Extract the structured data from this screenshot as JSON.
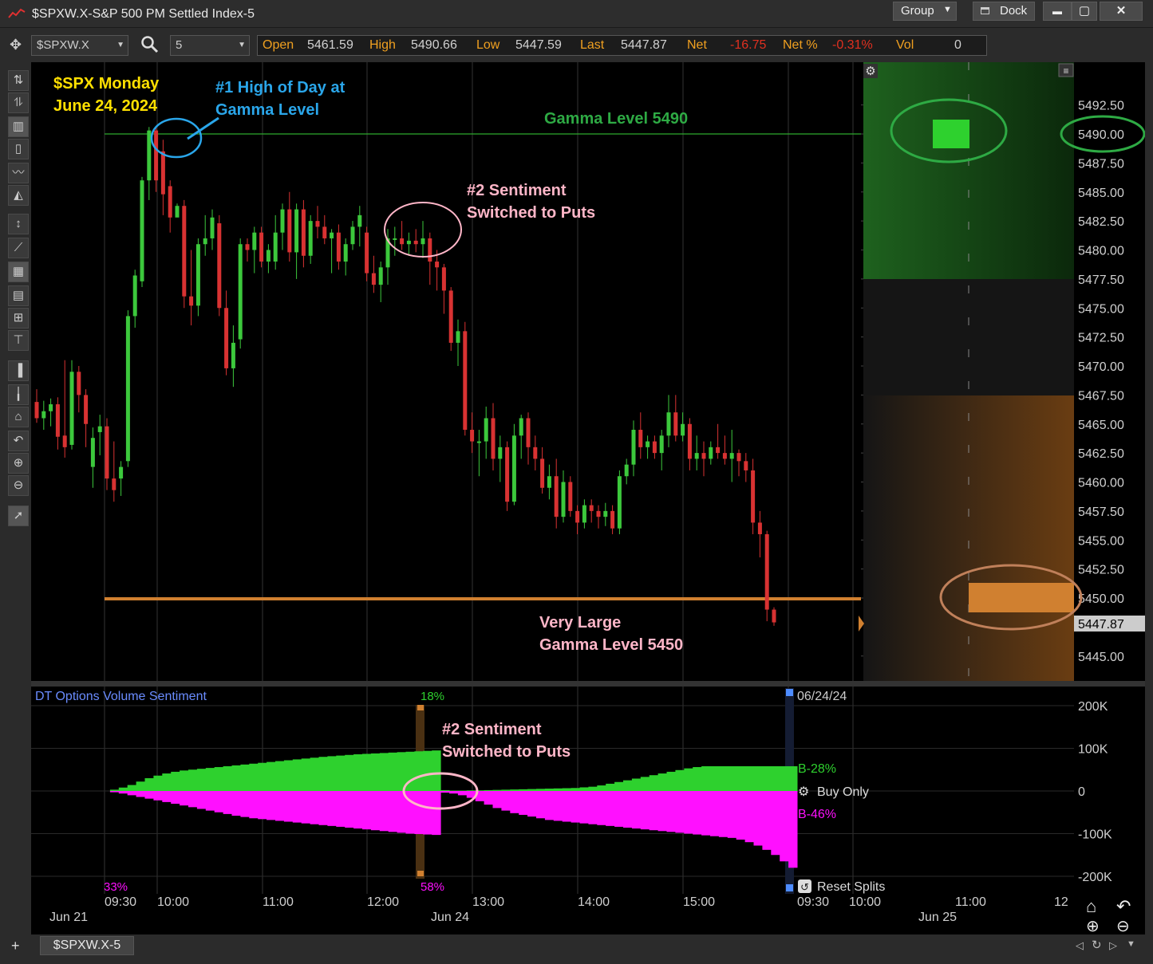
{
  "window": {
    "title": "$SPXW.X-S&P 500 PM Settled Index-5",
    "group_label": "Group",
    "dock_label": "Dock",
    "minimize_label": "▬",
    "maximize_label": "▢",
    "close_label": "✕"
  },
  "toolbar": {
    "symbol": "$SPXW.X",
    "interval": "5"
  },
  "quote": {
    "open_label": "Open",
    "open_value": "5461.59",
    "high_label": "High",
    "high_value": "5490.66",
    "low_label": "Low",
    "low_value": "5447.59",
    "last_label": "Last",
    "last_value": "5447.87",
    "net_label": "Net",
    "net_value": "-16.75",
    "netpct_label": "Net %",
    "netpct_value": "-0.31%",
    "vol_label": "Vol",
    "vol_value": "0"
  },
  "annotations": {
    "title_line1": "$SPX Monday",
    "title_line2": "June 24, 2024",
    "high_line1": "#1 High of Day at",
    "high_line2": "Gamma Level",
    "gamma_top": "Gamma Level 5490",
    "sentiment_line1": "#2 Sentiment",
    "sentiment_line2": "Switched to Puts",
    "gamma_bottom_line1": "Very Large",
    "gamma_bottom_line2": "Gamma Level 5450",
    "lower_sentiment_line1": "#2 Sentiment",
    "lower_sentiment_line2": "Switched to Puts"
  },
  "colors": {
    "bull": "#3cc83c",
    "bear": "#d83232",
    "gamma_top_line": "#2eaa2e",
    "gamma_bottom_line": "#d08030",
    "sentiment_calls": "#2ed12e",
    "sentiment_puts": "#ff10ff",
    "title_text": "#ffe000",
    "annotation_blue": "#2aa6ea",
    "annotation_green": "#2eaa44",
    "annotation_pink": "#ffb6c8"
  },
  "chart_data": [
    {
      "type": "candlestick",
      "title": "$SPXW.X-S&P 500 PM Settled Index-5",
      "interval_minutes": 5,
      "price_ticks": [
        "5492.50",
        "5490.00",
        "5487.50",
        "5485.00",
        "5482.50",
        "5480.00",
        "5477.50",
        "5475.00",
        "5472.50",
        "5470.00",
        "5467.50",
        "5465.00",
        "5462.50",
        "5460.00",
        "5457.50",
        "5455.00",
        "5452.50",
        "5450.00",
        "5447.87",
        "5445.00"
      ],
      "ylim": [
        5442.5,
        5494.5
      ],
      "time_ticks": [
        "09:30",
        "10:00",
        "11:00",
        "12:00",
        "13:00",
        "14:00",
        "15:00",
        "09:30",
        "10:00",
        "11:00",
        "12"
      ],
      "date_ticks": [
        "Jun 21",
        "Jun 24",
        "Jun 25"
      ],
      "gamma_levels": [
        5490,
        5450
      ],
      "last_price": 5447.87,
      "candles": [
        {
          "o": 5466.9,
          "h": 5468.0,
          "l": 5465.1,
          "c": 5465.5
        },
        {
          "o": 5465.5,
          "h": 5467.0,
          "l": 5464.5,
          "c": 5466.1
        },
        {
          "o": 5466.1,
          "h": 5467.2,
          "l": 5464.8,
          "c": 5466.7
        },
        {
          "o": 5466.7,
          "h": 5467.3,
          "l": 5462.8,
          "c": 5463.9
        },
        {
          "o": 5464.0,
          "h": 5470.5,
          "l": 5462.1,
          "c": 5463.0
        },
        {
          "o": 5463.2,
          "h": 5470.5,
          "l": 5462.8,
          "c": 5469.5
        },
        {
          "o": 5469.5,
          "h": 5470.0,
          "l": 5466.0,
          "c": 5467.5
        },
        {
          "o": 5467.5,
          "h": 5468.0,
          "l": 5463.0,
          "c": 5465.0
        },
        {
          "o": 5461.3,
          "h": 5464.7,
          "l": 5459.5,
          "c": 5463.8
        },
        {
          "o": 5464.3,
          "h": 5465.8,
          "l": 5462.3,
          "c": 5464.8
        },
        {
          "o": 5464.8,
          "h": 5465.5,
          "l": 5459.3,
          "c": 5460.3
        },
        {
          "o": 5460.3,
          "h": 5463.5,
          "l": 5458.3,
          "c": 5459.3
        },
        {
          "o": 5460.3,
          "h": 5461.8,
          "l": 5458.8,
          "c": 5461.3
        },
        {
          "o": 5461.8,
          "h": 5474.8,
          "l": 5461.3,
          "c": 5474.3
        },
        {
          "o": 5474.3,
          "h": 5478.3,
          "l": 5473.3,
          "c": 5477.8
        },
        {
          "o": 5477.3,
          "h": 5486.3,
          "l": 5476.8,
          "c": 5486.0
        },
        {
          "o": 5486.0,
          "h": 5490.6,
          "l": 5484.3,
          "c": 5490.3
        },
        {
          "o": 5490.3,
          "h": 5490.6,
          "l": 5485.0,
          "c": 5486.0
        },
        {
          "o": 5488.5,
          "h": 5489.5,
          "l": 5483.0,
          "c": 5484.8
        },
        {
          "o": 5485.5,
          "h": 5486.0,
          "l": 5481.5,
          "c": 5482.8
        },
        {
          "o": 5482.8,
          "h": 5484.0,
          "l": 5483.5,
          "c": 5483.8
        },
        {
          "o": 5483.8,
          "h": 5484.3,
          "l": 5475.0,
          "c": 5476.0
        },
        {
          "o": 5476.0,
          "h": 5480.0,
          "l": 5473.5,
          "c": 5475.2
        },
        {
          "o": 5475.2,
          "h": 5481.0,
          "l": 5474.3,
          "c": 5480.5
        },
        {
          "o": 5480.5,
          "h": 5483.0,
          "l": 5479.5,
          "c": 5481.0
        },
        {
          "o": 5481.0,
          "h": 5483.5,
          "l": 5480.0,
          "c": 5482.8
        },
        {
          "o": 5482.3,
          "h": 5483.0,
          "l": 5474.3,
          "c": 5475.0
        },
        {
          "o": 5475.0,
          "h": 5476.5,
          "l": 5469.2,
          "c": 5469.8
        },
        {
          "o": 5469.8,
          "h": 5473.5,
          "l": 5468.2,
          "c": 5472.0
        },
        {
          "o": 5472.3,
          "h": 5481.0,
          "l": 5471.5,
          "c": 5480.5
        },
        {
          "o": 5480.5,
          "h": 5481.0,
          "l": 5479.0,
          "c": 5480.0
        },
        {
          "o": 5480.0,
          "h": 5482.0,
          "l": 5478.0,
          "c": 5481.5
        },
        {
          "o": 5481.5,
          "h": 5482.0,
          "l": 5478.5,
          "c": 5479.0
        },
        {
          "o": 5479.0,
          "h": 5480.5,
          "l": 5478.0,
          "c": 5480.0
        },
        {
          "o": 5479.0,
          "h": 5483.0,
          "l": 5478.3,
          "c": 5481.5
        },
        {
          "o": 5481.5,
          "h": 5484.0,
          "l": 5480.0,
          "c": 5483.5
        },
        {
          "o": 5483.5,
          "h": 5485.0,
          "l": 5479.0,
          "c": 5479.8
        },
        {
          "o": 5479.8,
          "h": 5484.0,
          "l": 5477.5,
          "c": 5483.5
        },
        {
          "o": 5483.5,
          "h": 5484.3,
          "l": 5478.5,
          "c": 5479.5
        },
        {
          "o": 5479.5,
          "h": 5483.0,
          "l": 5478.8,
          "c": 5482.5
        },
        {
          "o": 5482.5,
          "h": 5483.8,
          "l": 5481.0,
          "c": 5482.0
        },
        {
          "o": 5482.0,
          "h": 5483.0,
          "l": 5480.5,
          "c": 5481.0
        },
        {
          "o": 5481.0,
          "h": 5481.8,
          "l": 5478.0,
          "c": 5481.5
        },
        {
          "o": 5481.5,
          "h": 5482.2,
          "l": 5478.3,
          "c": 5479.0
        },
        {
          "o": 5479.0,
          "h": 5481.0,
          "l": 5477.8,
          "c": 5480.5
        },
        {
          "o": 5480.5,
          "h": 5482.5,
          "l": 5480.0,
          "c": 5482.0
        },
        {
          "o": 5482.0,
          "h": 5483.8,
          "l": 5480.3,
          "c": 5483.0
        },
        {
          "o": 5481.5,
          "h": 5482.0,
          "l": 5477.3,
          "c": 5478.0
        },
        {
          "o": 5478.0,
          "h": 5479.5,
          "l": 5476.3,
          "c": 5477.0
        },
        {
          "o": 5477.0,
          "h": 5479.0,
          "l": 5475.5,
          "c": 5478.5
        },
        {
          "o": 5478.5,
          "h": 5481.8,
          "l": 5477.0,
          "c": 5481.0
        },
        {
          "o": 5481.0,
          "h": 5482.0,
          "l": 5479.5,
          "c": 5481.0
        },
        {
          "o": 5481.0,
          "h": 5482.5,
          "l": 5480.0,
          "c": 5480.5
        },
        {
          "o": 5480.5,
          "h": 5481.5,
          "l": 5479.5,
          "c": 5480.8
        },
        {
          "o": 5480.8,
          "h": 5481.8,
          "l": 5479.8,
          "c": 5480.5
        },
        {
          "o": 5480.5,
          "h": 5482.5,
          "l": 5479.3,
          "c": 5481.0
        },
        {
          "o": 5481.0,
          "h": 5481.5,
          "l": 5477.0,
          "c": 5479.0
        },
        {
          "o": 5479.0,
          "h": 5480.0,
          "l": 5476.5,
          "c": 5478.5
        },
        {
          "o": 5478.5,
          "h": 5478.8,
          "l": 5474.5,
          "c": 5476.5
        },
        {
          "o": 5476.5,
          "h": 5476.8,
          "l": 5471.3,
          "c": 5472.0
        },
        {
          "o": 5472.0,
          "h": 5474.0,
          "l": 5470.0,
          "c": 5473.0
        },
        {
          "o": 5473.0,
          "h": 5473.8,
          "l": 5464.0,
          "c": 5464.5
        },
        {
          "o": 5464.5,
          "h": 5466.0,
          "l": 5462.5,
          "c": 5463.5
        },
        {
          "o": 5463.5,
          "h": 5464.5,
          "l": 5460.5,
          "c": 5463.5
        },
        {
          "o": 5463.5,
          "h": 5466.5,
          "l": 5462.0,
          "c": 5465.5
        },
        {
          "o": 5465.5,
          "h": 5466.8,
          "l": 5461.0,
          "c": 5462.0
        },
        {
          "o": 5462.0,
          "h": 5464.0,
          "l": 5460.0,
          "c": 5463.0
        },
        {
          "o": 5463.0,
          "h": 5463.5,
          "l": 5457.5,
          "c": 5458.3
        },
        {
          "o": 5458.3,
          "h": 5465.0,
          "l": 5458.0,
          "c": 5464.0
        },
        {
          "o": 5464.0,
          "h": 5465.8,
          "l": 5462.0,
          "c": 5465.5
        },
        {
          "o": 5465.5,
          "h": 5466.0,
          "l": 5461.5,
          "c": 5463.0
        },
        {
          "o": 5463.0,
          "h": 5464.0,
          "l": 5461.0,
          "c": 5462.0
        },
        {
          "o": 5462.0,
          "h": 5463.0,
          "l": 5459.0,
          "c": 5459.5
        },
        {
          "o": 5459.5,
          "h": 5461.5,
          "l": 5458.5,
          "c": 5460.5
        },
        {
          "o": 5460.5,
          "h": 5462.0,
          "l": 5456.0,
          "c": 5457.0
        },
        {
          "o": 5457.0,
          "h": 5461.0,
          "l": 5456.5,
          "c": 5460.0
        },
        {
          "o": 5460.0,
          "h": 5460.5,
          "l": 5457.0,
          "c": 5457.5
        },
        {
          "o": 5457.5,
          "h": 5458.0,
          "l": 5455.5,
          "c": 5456.5
        },
        {
          "o": 5456.5,
          "h": 5458.5,
          "l": 5456.0,
          "c": 5458.0
        },
        {
          "o": 5458.0,
          "h": 5458.5,
          "l": 5456.5,
          "c": 5457.5
        },
        {
          "o": 5457.5,
          "h": 5458.0,
          "l": 5456.0,
          "c": 5457.0
        },
        {
          "o": 5457.0,
          "h": 5458.2,
          "l": 5456.2,
          "c": 5457.5
        },
        {
          "o": 5457.5,
          "h": 5458.0,
          "l": 5455.5,
          "c": 5456.0
        },
        {
          "o": 5456.0,
          "h": 5461.0,
          "l": 5455.5,
          "c": 5460.5
        },
        {
          "o": 5460.5,
          "h": 5462.0,
          "l": 5459.8,
          "c": 5461.5
        },
        {
          "o": 5461.5,
          "h": 5465.3,
          "l": 5460.5,
          "c": 5464.5
        },
        {
          "o": 5464.5,
          "h": 5466.0,
          "l": 5462.0,
          "c": 5463.0
        },
        {
          "o": 5463.0,
          "h": 5464.0,
          "l": 5462.0,
          "c": 5463.5
        },
        {
          "o": 5463.5,
          "h": 5464.0,
          "l": 5462.0,
          "c": 5462.5
        },
        {
          "o": 5462.5,
          "h": 5464.5,
          "l": 5461.0,
          "c": 5464.0
        },
        {
          "o": 5464.0,
          "h": 5467.5,
          "l": 5463.0,
          "c": 5466.0
        },
        {
          "o": 5466.0,
          "h": 5467.5,
          "l": 5463.5,
          "c": 5464.0
        },
        {
          "o": 5464.0,
          "h": 5466.0,
          "l": 5463.5,
          "c": 5465.0
        },
        {
          "o": 5465.0,
          "h": 5465.5,
          "l": 5461.0,
          "c": 5462.0
        },
        {
          "o": 5462.0,
          "h": 5464.0,
          "l": 5461.0,
          "c": 5462.5
        },
        {
          "o": 5462.5,
          "h": 5463.5,
          "l": 5460.5,
          "c": 5462.0
        },
        {
          "o": 5462.0,
          "h": 5463.5,
          "l": 5461.5,
          "c": 5463.0
        },
        {
          "o": 5463.0,
          "h": 5465.0,
          "l": 5462.0,
          "c": 5462.5
        },
        {
          "o": 5462.5,
          "h": 5464.0,
          "l": 5461.5,
          "c": 5462.0
        },
        {
          "o": 5462.0,
          "h": 5464.5,
          "l": 5460.0,
          "c": 5462.5
        },
        {
          "o": 5462.5,
          "h": 5462.8,
          "l": 5460.5,
          "c": 5461.8
        },
        {
          "o": 5461.8,
          "h": 5462.5,
          "l": 5460.0,
          "c": 5461.0
        },
        {
          "o": 5461.0,
          "h": 5462.0,
          "l": 5455.5,
          "c": 5456.5
        },
        {
          "o": 5456.5,
          "h": 5457.5,
          "l": 5453.5,
          "c": 5455.5
        },
        {
          "o": 5455.5,
          "h": 5455.8,
          "l": 5448.0,
          "c": 5449.0
        },
        {
          "o": 5449.0,
          "h": 5449.2,
          "l": 5447.6,
          "c": 5447.9
        }
      ]
    },
    {
      "type": "area",
      "title": "DT Options Volume Sentiment",
      "y_ticks": [
        "200K",
        "100K",
        "0",
        "-100K",
        "-200K"
      ],
      "ylim": [
        -200000,
        200000
      ],
      "calls_label": "B-28%",
      "puts_label": "B-46%",
      "marker_top_label": "18%",
      "marker_bottom_label": "58%",
      "left_pct_label": "33%",
      "date_label": "06/24/24",
      "buy_only_label": "Buy Only",
      "reset_splits_label": "Reset Splits",
      "series": [
        {
          "name": "B-28%",
          "values": [
            0,
            3000,
            8000,
            14000,
            22000,
            30000,
            36000,
            41000,
            45000,
            48000,
            50000,
            52000,
            54000,
            56000,
            58000,
            60000,
            62000,
            64000,
            66000,
            68000,
            70000,
            72000,
            74000,
            76000,
            78000,
            80000,
            81500,
            83000,
            84500,
            86000,
            87000,
            88000,
            89000,
            90000,
            91000,
            92000,
            93000,
            94000,
            95000,
            2000,
            1000,
            1000,
            1500,
            1500,
            2000,
            2500,
            3000,
            3500,
            4000,
            4500,
            5000,
            5500,
            6000,
            6500,
            7000,
            8500,
            10000,
            13000,
            17000,
            21000,
            25000,
            29000,
            33000,
            37000,
            41000,
            45000,
            49000,
            53000,
            56000,
            58000,
            58000,
            58000,
            58000,
            58000,
            58000,
            58000,
            58000,
            58000,
            58000,
            58000
          ]
        },
        {
          "name": "B-46%",
          "values": [
            0,
            -3000,
            -6000,
            -10000,
            -14000,
            -18000,
            -22000,
            -26000,
            -30000,
            -34000,
            -38000,
            -42000,
            -46000,
            -50000,
            -54000,
            -58000,
            -61000,
            -64000,
            -66000,
            -68000,
            -70000,
            -72000,
            -74000,
            -76000,
            -78000,
            -80000,
            -82000,
            -84000,
            -86000,
            -88000,
            -90000,
            -92000,
            -94000,
            -96000,
            -98000,
            -100000,
            -101000,
            -102000,
            -103000,
            -4000,
            -6000,
            -10000,
            -16000,
            -24000,
            -32000,
            -40000,
            -46000,
            -52000,
            -56000,
            -60000,
            -64000,
            -68000,
            -70000,
            -72000,
            -74000,
            -76000,
            -78000,
            -80000,
            -82000,
            -84000,
            -86000,
            -88000,
            -90000,
            -92000,
            -94000,
            -96000,
            -98000,
            -100000,
            -102000,
            -104000,
            -106000,
            -108000,
            -110000,
            -114000,
            -120000,
            -128000,
            -138000,
            -150000,
            -165000,
            -180000
          ]
        }
      ]
    }
  ]
}
